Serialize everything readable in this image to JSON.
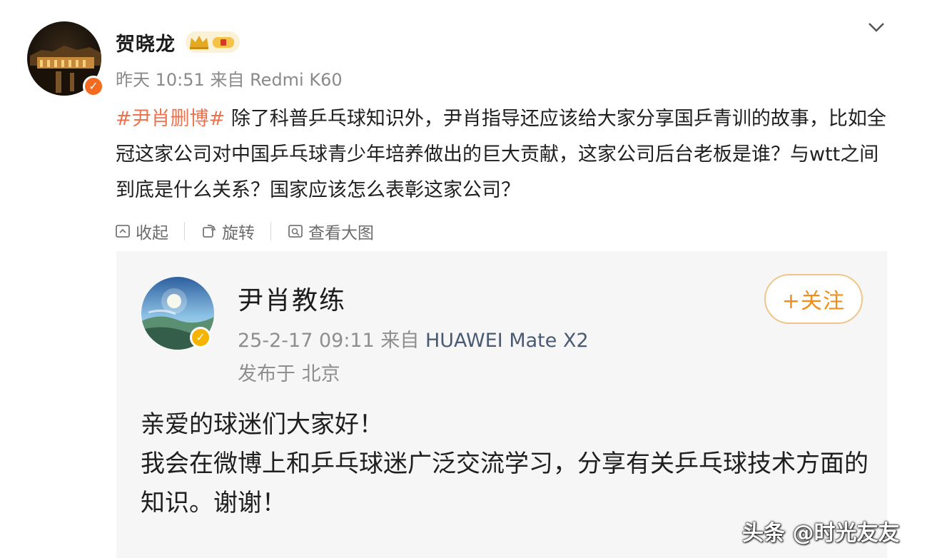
{
  "post": {
    "author": "贺晓龙",
    "time": "昨天 10:51",
    "source_prefix": "来自",
    "device": "Redmi K60",
    "hashtag": "#尹肖删博#",
    "text": " 除了科普乒乓球知识外，尹肖指导还应该给大家分享国乒青训的故事，比如全冠这家公司对中国乒乓球青少年培养做出的巨大贡献，这家公司后台老板是谁？与wtt之间到底是什么关系？国家应该怎么表彰这家公司？",
    "actions": {
      "collapse": "收起",
      "rotate": "旋转",
      "view_large": "查看大图"
    }
  },
  "quoted": {
    "author": "尹肖教练",
    "follow_label": "+关注",
    "time": "25-2-17 09:11",
    "source_prefix": "来自",
    "device": "HUAWEI Mate X2",
    "location": "发布于 北京",
    "line1": "亲爱的球迷们大家好！",
    "line2": "我会在微博上和乒乓球迷广泛交流学习，分享有关乒乓球技术方面的知识。谢谢！"
  },
  "watermark": "头条 @时光友友",
  "icons": {
    "collapse": "collapse-icon",
    "rotate": "rotate-icon",
    "view_large": "view-large-icon",
    "more": "chevron-down-icon",
    "verified": "verified-badge-icon",
    "level": "crown-level-badge-icon"
  },
  "colors": {
    "hashtag": "#eb7350",
    "follow": "#f38d19",
    "verified_orange": "#f26b21",
    "verified_yellow": "#f5b400"
  }
}
